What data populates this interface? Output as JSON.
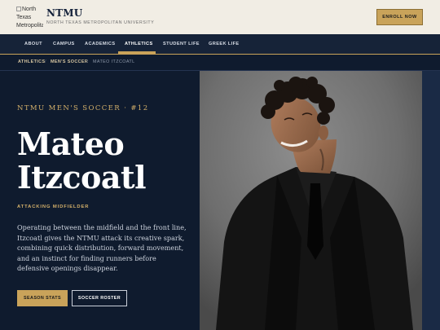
{
  "header": {
    "logo_alt": "North Texas Metropolitan",
    "brand_name": "NTMU",
    "brand_subtitle": "NORTH TEXAS METROPOLITAN UNIVERSITY",
    "enroll_label": "ENROLL NOW"
  },
  "nav": {
    "items": [
      {
        "label": "ABOUT"
      },
      {
        "label": "CAMPUS"
      },
      {
        "label": "ACADEMICS"
      },
      {
        "label": "ATHLETICS"
      },
      {
        "label": "STUDENT LIFE"
      },
      {
        "label": "GREEK LIFE"
      }
    ],
    "active": "ATHLETICS"
  },
  "breadcrumb": {
    "items": [
      "ATHLETICS",
      "MEN'S SOCCER",
      "MATEO ITZCOATL"
    ],
    "separator": "/"
  },
  "hero": {
    "eyebrow": "NTMU MEN'S SOCCER · #12",
    "first_name": "Mateo",
    "last_name": "Itzcoatl",
    "position": "ATTACKING MIDFIELDER",
    "bio": "Operating between the midfield and the front line, Itzcoatl gives the NTMU attack its creative spark, combining quick distribution, forward movement, and an instinct for finding runners before defensive openings disappear.",
    "primary_button": "SEASON STATS",
    "secondary_button": "SOCCER ROSTER"
  },
  "colors": {
    "navy": "#0f1b2e",
    "gold": "#c9a35a",
    "cream": "#f1ede4"
  }
}
